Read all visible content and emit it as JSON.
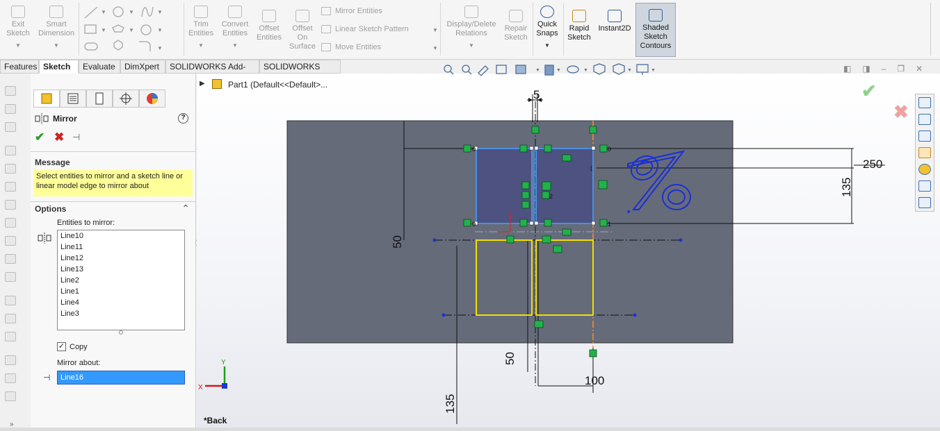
{
  "ribbon": {
    "exit_sketch": "Exit\nSketch",
    "smart_dimension": "Smart\nDimension",
    "trim_entities": "Trim\nEntities",
    "convert_entities": "Convert\nEntities",
    "offset_entities": "Offset\nEntities",
    "offset_on_surface": "Offset\nOn\nSurface",
    "mirror_entities": "Mirror Entities",
    "linear_sketch_pattern": "Linear Sketch Pattern",
    "move_entities": "Move Entities",
    "display_delete_relations": "Display/Delete\nRelations",
    "repair_sketch": "Repair\nSketch",
    "quick_snaps": "Quick\nSnaps",
    "rapid_sketch": "Rapid\nSketch",
    "instant2d": "Instant2D",
    "shaded_sketch_contours": "Shaded\nSketch\nContours"
  },
  "tabs": [
    "Features",
    "Sketch",
    "Evaluate",
    "DimXpert",
    "SOLIDWORKS Add-Ins",
    "SOLIDWORKS MBD"
  ],
  "active_tab": "Sketch",
  "feature_tree": {
    "root_label": "Part1  (Default<<Default>..."
  },
  "property_manager": {
    "title": "Mirror",
    "help": "?",
    "message_header": "Message",
    "message": "Select entities to mirror and a sketch line or linear model edge to mirror about",
    "options_header": "Options",
    "entities_label": "Entities to mirror:",
    "entities": [
      "Line10",
      "Line11",
      "Line12",
      "Line13",
      "Line2",
      "Line1",
      "Line4",
      "Line3"
    ],
    "copy_label": "Copy",
    "copy_checked": true,
    "mirror_about_label": "Mirror about:",
    "mirror_about_value": "Line16"
  },
  "viewport": {
    "view_label": "*Back",
    "dims": {
      "d5": "5",
      "d250": "250",
      "d135_right": "135",
      "d50_left": "50",
      "d50_bottom": "50",
      "d100": "100",
      "d135_bottom": "135"
    },
    "axis_y": "Y",
    "axis_x": "X"
  },
  "colors": {
    "plate": "#666b7a",
    "selected_blue": "#4a90e2",
    "mirrored_yellow": "#f0e000",
    "relation_green": "#22b14c",
    "centerline_orange": "#ff8c1a",
    "confirm_green": "#5cb85c",
    "cancel_red": "#d9534f"
  }
}
